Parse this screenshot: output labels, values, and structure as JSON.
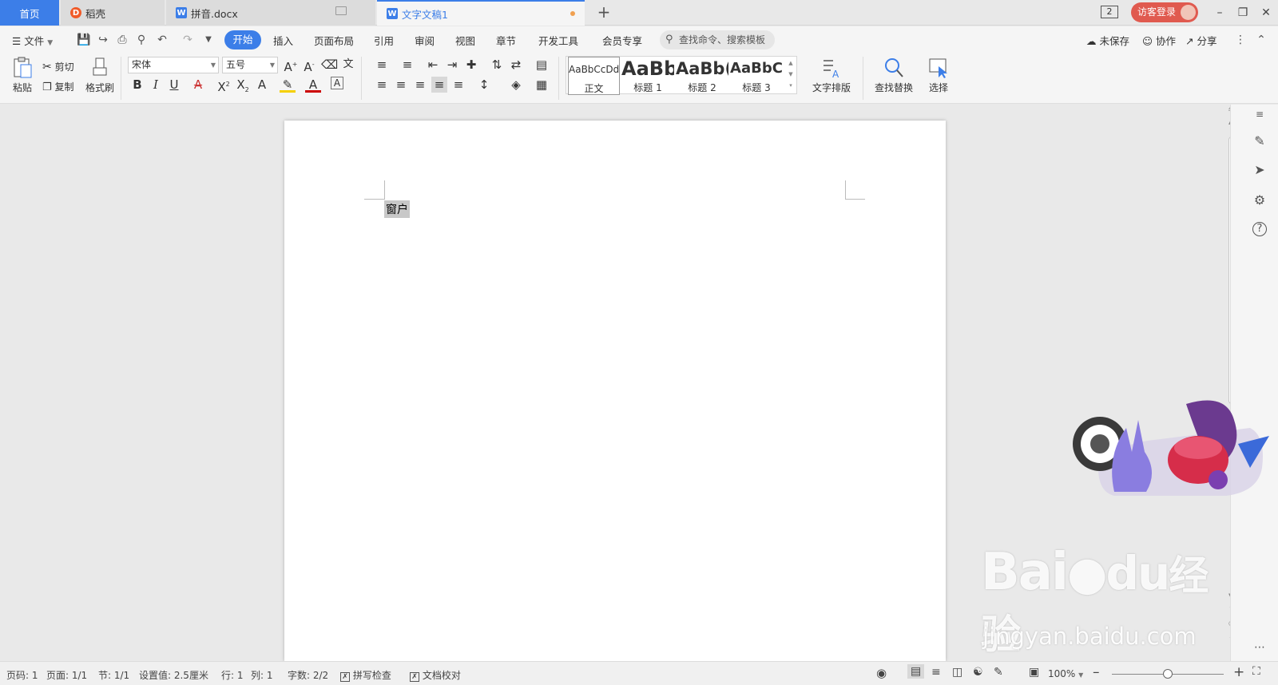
{
  "tabs": {
    "home": "首页",
    "daoke": "稻壳",
    "pinyin": "拼音.docx",
    "current": "文字文稿1"
  },
  "titlebar": {
    "window_count": "2",
    "login": "访客登录"
  },
  "menu": {
    "file": "文件",
    "items": [
      "开始",
      "插入",
      "页面布局",
      "引用",
      "审阅",
      "视图",
      "章节",
      "开发工具",
      "会员专享"
    ],
    "search_placeholder": "查找命令、搜索模板",
    "unsaved": "未保存",
    "collab": "协作",
    "share": "分享"
  },
  "ribbon": {
    "paste": "粘贴",
    "cut": "剪切",
    "copy": "复制",
    "format_painter": "格式刷",
    "font_name": "宋体",
    "font_size": "五号",
    "styles": [
      {
        "preview": "AaBbCcDd",
        "label": "正文"
      },
      {
        "preview": "AaBb",
        "label": "标题 1"
      },
      {
        "preview": "AaBb(",
        "label": "标题 2"
      },
      {
        "preview": "AaBbC",
        "label": "标题 3"
      }
    ],
    "text_layout": "文字排版",
    "find_replace": "查找替换",
    "select": "选择"
  },
  "document": {
    "selected_text": "窗户"
  },
  "watermark": {
    "logo_left": "Bai",
    "logo_right": "经验",
    "url": "jingyan.baidu.com"
  },
  "statusbar": {
    "page_no": "页码: 1",
    "pages": "页面: 1/1",
    "section": "节: 1/1",
    "setting": "设置值: 2.5厘米",
    "row": "行: 1",
    "col": "列: 1",
    "word_count": "字数: 2/2",
    "spell_check": "拼写检查",
    "proofread": "文档校对",
    "zoom": "100%",
    "zoom_level": 0.5
  },
  "colors": {
    "accent": "#3c7ee8",
    "login": "#e05a4f",
    "selection": "#c8c8c8"
  }
}
